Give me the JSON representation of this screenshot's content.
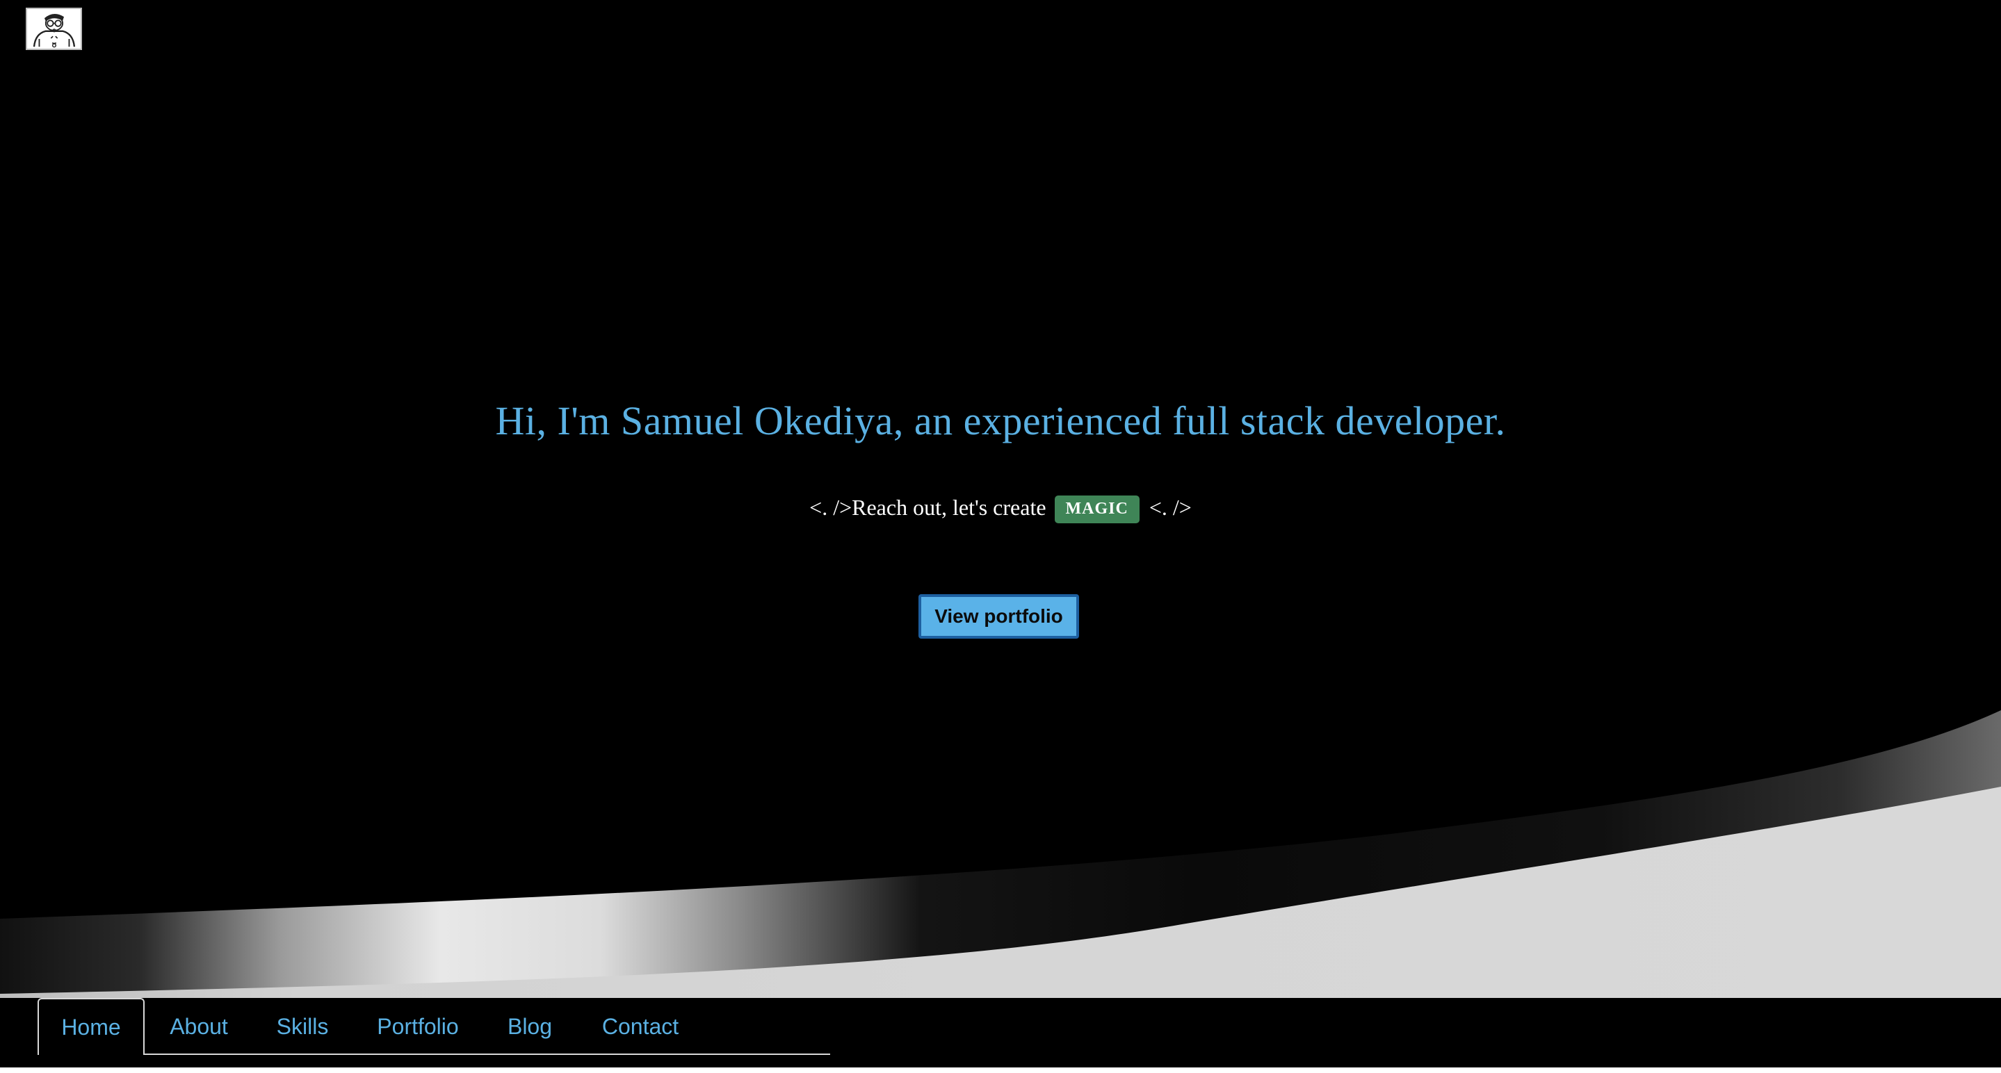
{
  "logo": {
    "icon": "developer-avatar-icon"
  },
  "hero": {
    "title": "Hi, I'm Samuel Okediya, an experienced full stack developer.",
    "tagline_prefix": "<. />Reach out, let's create",
    "badge": "MAGIC",
    "tagline_suffix": "<. />",
    "cta_label": "View portfolio"
  },
  "nav": {
    "items": [
      {
        "label": "Home",
        "active": true
      },
      {
        "label": "About",
        "active": false
      },
      {
        "label": "Skills",
        "active": false
      },
      {
        "label": "Portfolio",
        "active": false
      },
      {
        "label": "Blog",
        "active": false
      },
      {
        "label": "Contact",
        "active": false
      }
    ]
  },
  "colors": {
    "background": "#000000",
    "accent": "#5bb1e3",
    "badge": "#3f8557",
    "button_bg": "#5ab2e8",
    "button_border": "#1d5fa0",
    "wave_light": "#d6d6d6"
  }
}
